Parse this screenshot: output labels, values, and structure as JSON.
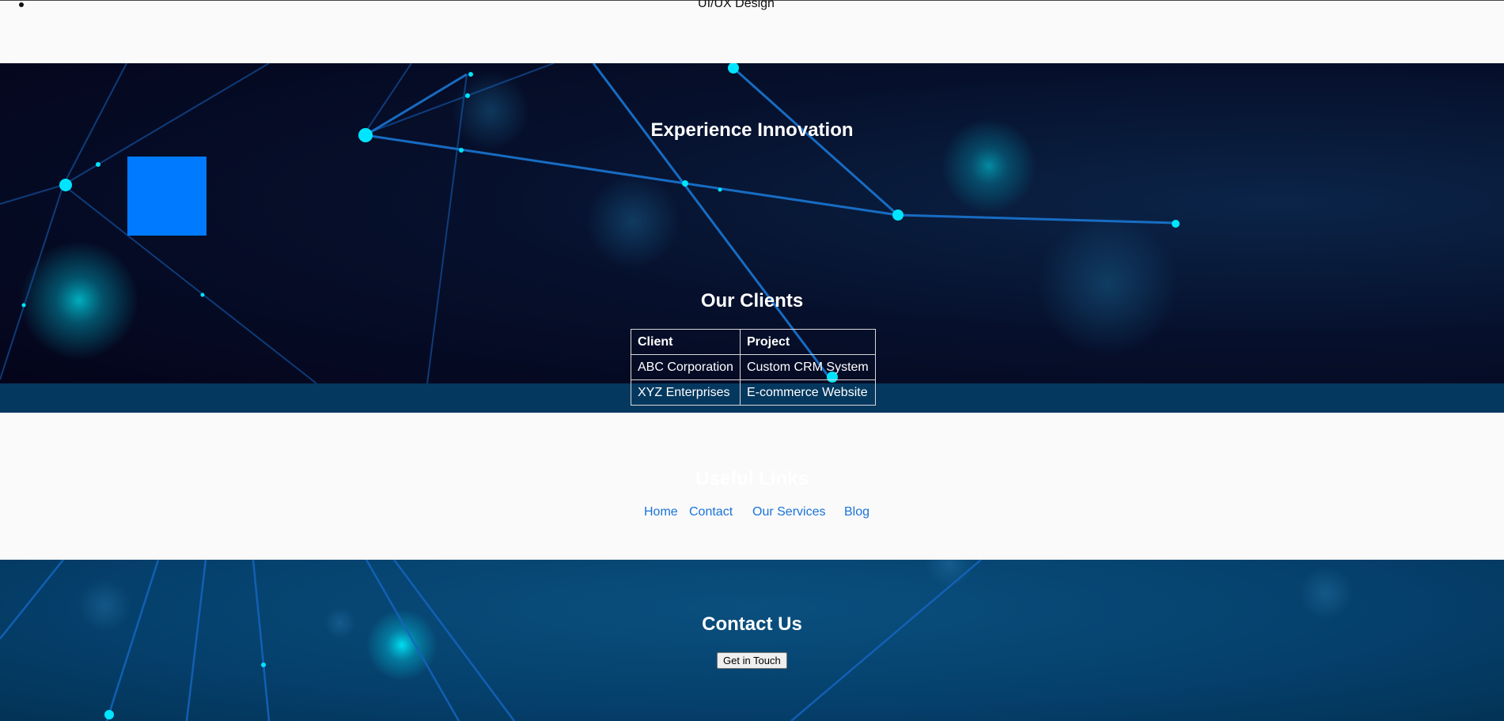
{
  "services_list": {
    "last_item": "UI/UX Design"
  },
  "hero": {
    "title": "Experience Innovation"
  },
  "clients": {
    "title": "Our Clients",
    "headers": [
      "Client",
      "Project"
    ],
    "rows": [
      [
        "ABC Corporation",
        "Custom CRM System"
      ],
      [
        "XYZ Enterprises",
        "E-commerce Website"
      ]
    ]
  },
  "links": {
    "title": "Useful Links",
    "items": [
      "Home",
      "Contact",
      "Our Services",
      "Blog"
    ]
  },
  "contact": {
    "title": "Contact Us",
    "button_label": "Get in Touch"
  },
  "colors": {
    "accent": "#007bff",
    "link": "#1a73d9",
    "network_node": "#00e5ff"
  }
}
